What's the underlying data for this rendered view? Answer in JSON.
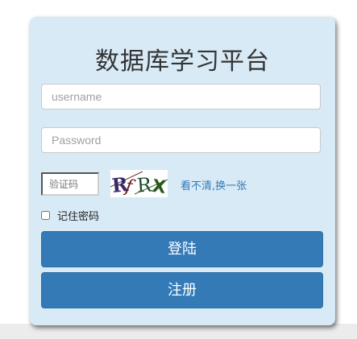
{
  "login_form": {
    "title": "数据库学习平台",
    "username": {
      "value": "",
      "placeholder": "username"
    },
    "password": {
      "value": "",
      "placeholder": "Password"
    },
    "captcha": {
      "placeholder": "验证码",
      "image_text": "RfRX",
      "refresh_link": "看不清,换一张"
    },
    "remember": {
      "label": "记住密码",
      "checked": false
    },
    "login_button": "登陆",
    "register_button": "注册"
  },
  "colors": {
    "card_background": "#d8eaf6",
    "button_primary": "#337ab7",
    "link": "#337ab7",
    "page_footer": "#ececec"
  }
}
